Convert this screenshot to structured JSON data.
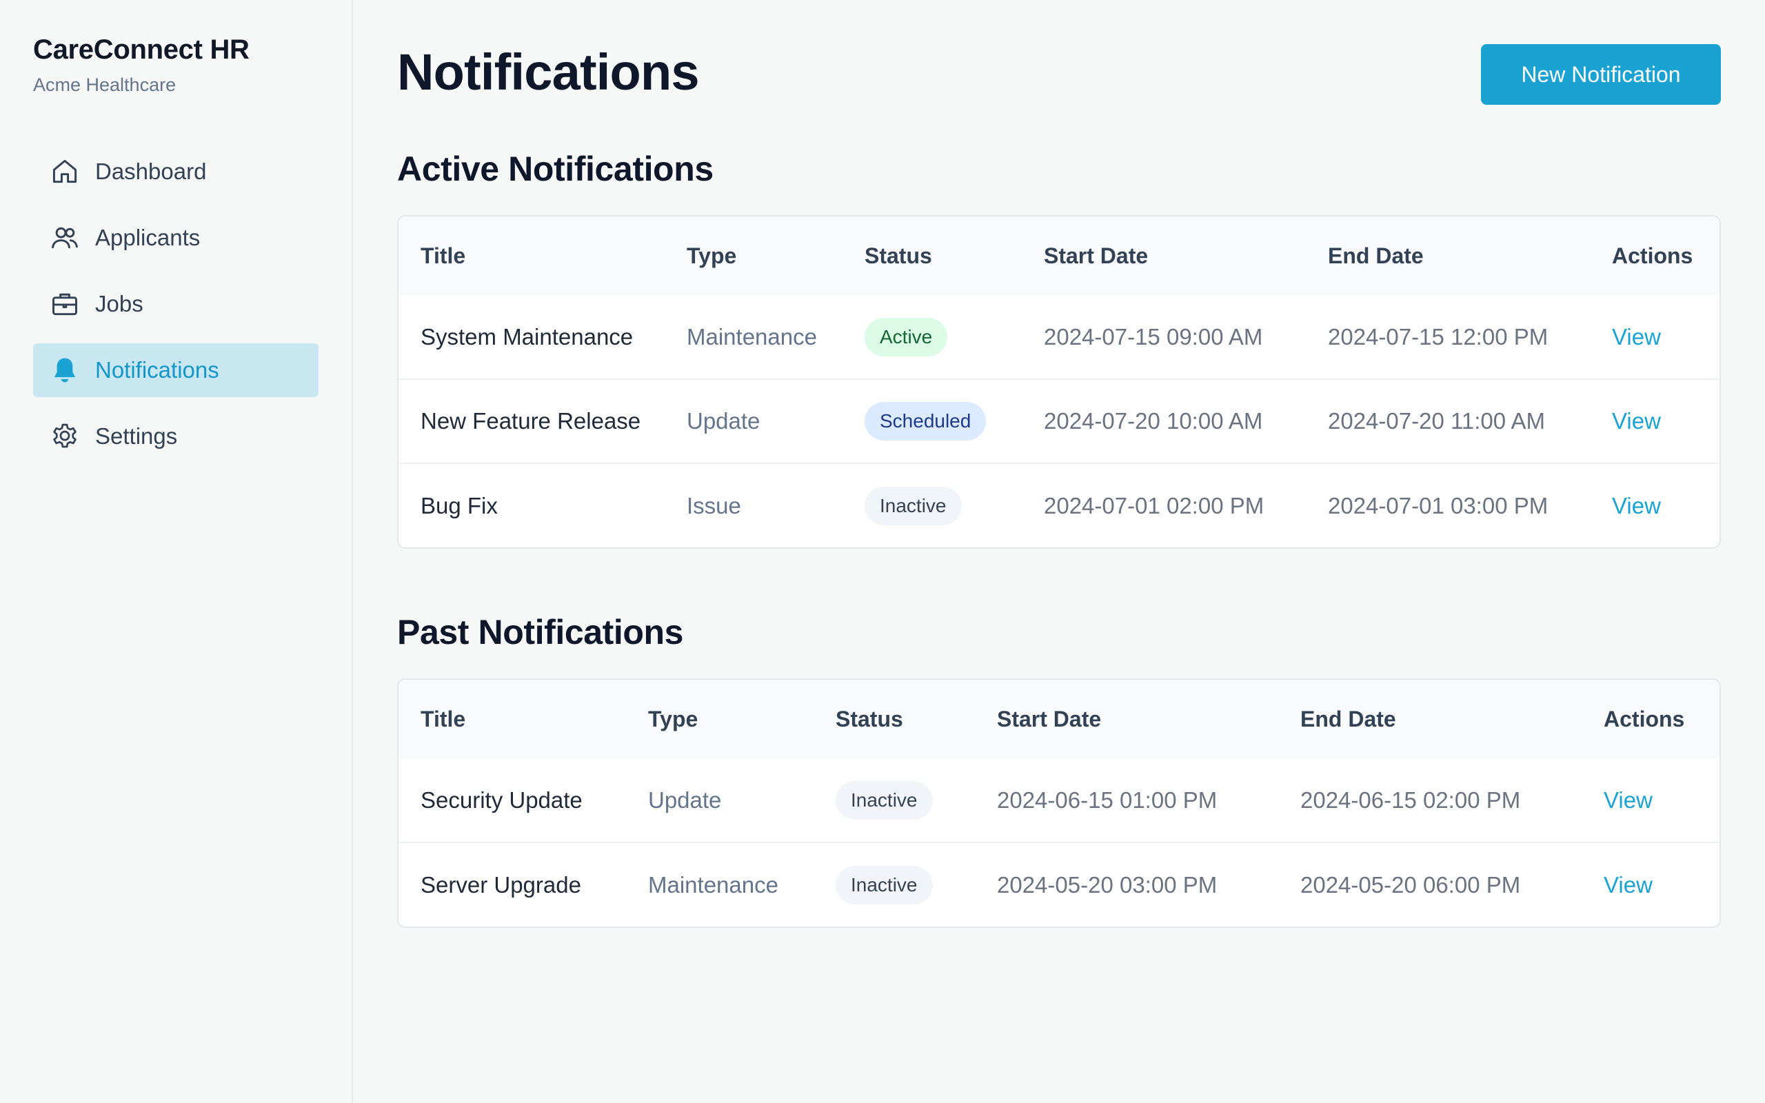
{
  "sidebar": {
    "title": "CareConnect HR",
    "org": "Acme Healthcare",
    "items": [
      {
        "label": "Dashboard",
        "icon": "home-icon"
      },
      {
        "label": "Applicants",
        "icon": "users-icon"
      },
      {
        "label": "Jobs",
        "icon": "briefcase-icon"
      },
      {
        "label": "Notifications",
        "icon": "bell-icon",
        "active": true
      },
      {
        "label": "Settings",
        "icon": "gear-icon"
      }
    ]
  },
  "header": {
    "title": "Notifications",
    "new_button": "New Notification"
  },
  "active": {
    "title": "Active Notifications",
    "columns": [
      "Title",
      "Type",
      "Status",
      "Start Date",
      "End Date",
      "Actions"
    ],
    "rows": [
      {
        "title": "System Maintenance",
        "type": "Maintenance",
        "status": "Active",
        "start": "2024-07-15 09:00 AM",
        "end": "2024-07-15 12:00 PM",
        "action": "View"
      },
      {
        "title": "New Feature Release",
        "type": "Update",
        "status": "Scheduled",
        "start": "2024-07-20 10:00 AM",
        "end": "2024-07-20 11:00 AM",
        "action": "View"
      },
      {
        "title": "Bug Fix",
        "type": "Issue",
        "status": "Inactive",
        "start": "2024-07-01 02:00 PM",
        "end": "2024-07-01 03:00 PM",
        "action": "View"
      }
    ]
  },
  "past": {
    "title": "Past Notifications",
    "columns": [
      "Title",
      "Type",
      "Status",
      "Start Date",
      "End Date",
      "Actions"
    ],
    "rows": [
      {
        "title": "Security Update",
        "type": "Update",
        "status": "Inactive",
        "start": "2024-06-15 01:00 PM",
        "end": "2024-06-15 02:00 PM",
        "action": "View"
      },
      {
        "title": "Server Upgrade",
        "type": "Maintenance",
        "status": "Inactive",
        "start": "2024-05-20 03:00 PM",
        "end": "2024-05-20 06:00 PM",
        "action": "View"
      }
    ]
  },
  "colors": {
    "accent": "#1aa3d2",
    "active_nav_bg": "#c8e7f0",
    "badge_active_bg": "#dcfce7",
    "badge_scheduled_bg": "#dbeafe",
    "badge_inactive_bg": "#f1f5f9"
  }
}
